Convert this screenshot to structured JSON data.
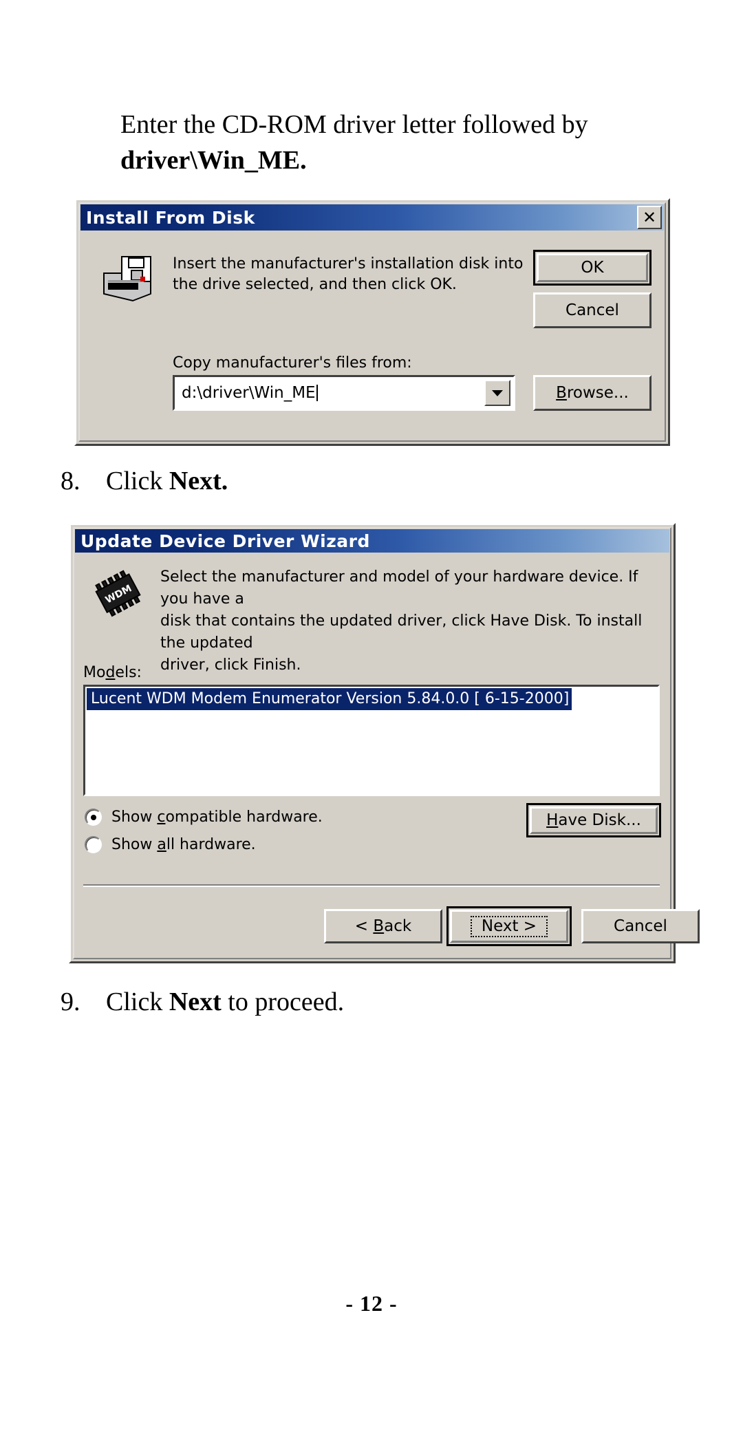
{
  "document": {
    "intro_line1": "Enter the CD-ROM driver letter followed by",
    "intro_line2": "driver\\Win_ME.",
    "step8_number": "8.",
    "step8_text_pre": "Click ",
    "step8_text_bold": "Next.",
    "step9_number": "9.",
    "step9_text_pre": "Click ",
    "step9_text_bold": "Next",
    "step9_text_post": " to proceed.",
    "page_number": "- 12 -"
  },
  "install_from_disk_dialog": {
    "title": "Install From Disk",
    "close_label": "✕",
    "icon_name": "floppy-disk-drive-icon",
    "message_line1": "Insert the manufacturer's installation disk into",
    "message_line2": "the drive selected, and then click OK.",
    "ok_label": "OK",
    "cancel_label": "Cancel",
    "copy_from_label": "Copy manufacturer's files from:",
    "path_value": "d:\\driver\\Win_ME",
    "browse_label_acc": "B",
    "browse_label_rest": "rowse..."
  },
  "update_device_driver_wizard": {
    "title": "Update Device Driver Wizard",
    "icon_name": "wdm-chip-icon",
    "message_line1": "Select the manufacturer and model of your hardware device. If you have a",
    "message_line2": "disk that contains the updated driver, click Have Disk.  To install the updated",
    "message_line3": "driver, click Finish.",
    "models_label_pre": "Mo",
    "models_label_acc": "d",
    "models_label_post": "els:",
    "models_selected_item": "Lucent WDM Modem Enumerator Version 5.84.0.0 [ 6-15-2000]",
    "radio_compatible_pre": "Show ",
    "radio_compatible_acc": "c",
    "radio_compatible_post": "ompatible hardware.",
    "radio_all_pre": "Show ",
    "radio_all_acc": "a",
    "radio_all_post": "ll hardware.",
    "have_disk_acc": "H",
    "have_disk_rest": "ave Disk...",
    "back_pre": "< ",
    "back_acc": "B",
    "back_post": "ack",
    "next_label": "Next >",
    "cancel_label": "Cancel"
  },
  "colors": {
    "title_bar_start": "#0a246a",
    "title_bar_end": "#a6c0dd",
    "dialog_face": "#d4d0c8",
    "selection_blue": "#0a246a",
    "text_black": "#000000"
  }
}
